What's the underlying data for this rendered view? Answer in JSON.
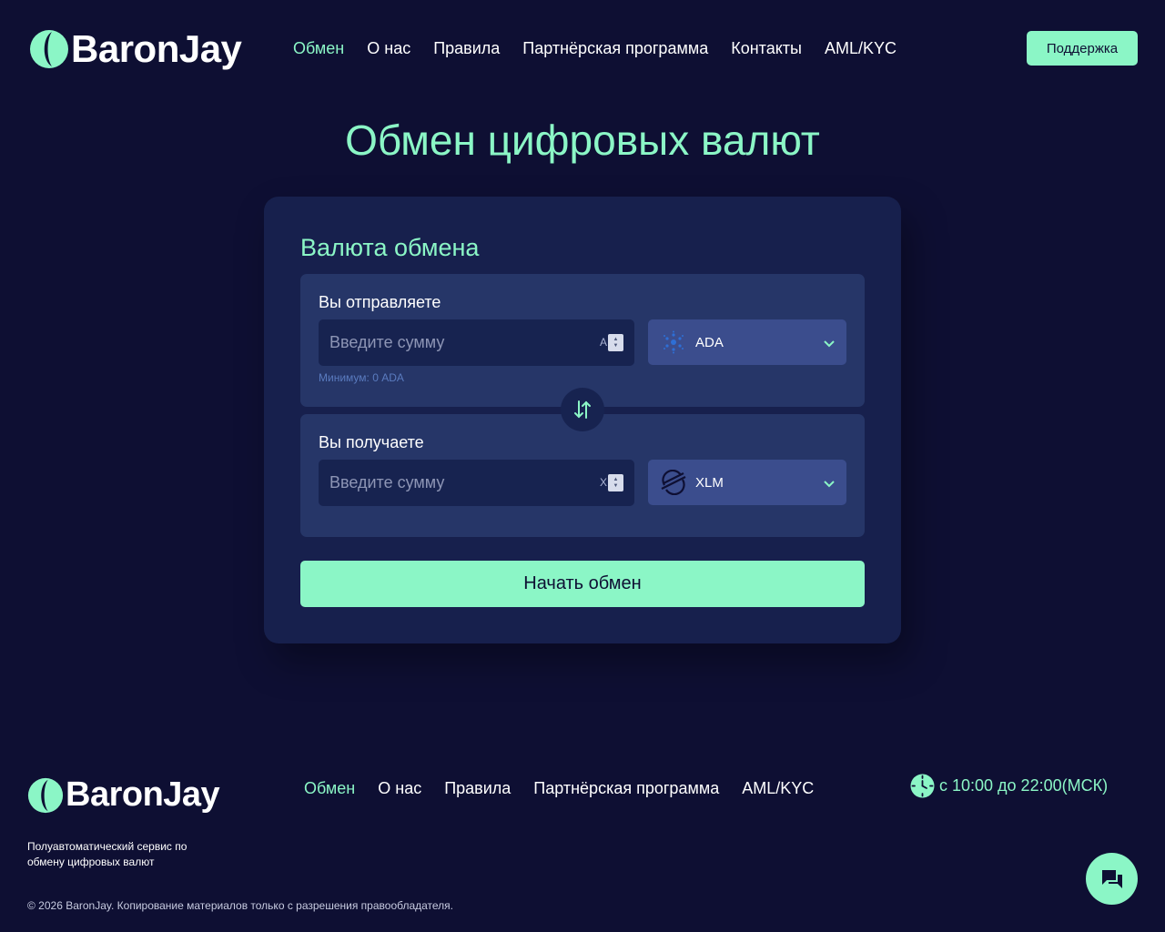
{
  "brand": {
    "name": "BaronJay",
    "accent_color": "#8bf6c6",
    "background_color": "#0e0f33"
  },
  "header": {
    "nav": [
      {
        "label": "Обмен",
        "active": true
      },
      {
        "label": "О нас",
        "active": false
      },
      {
        "label": "Правила",
        "active": false
      },
      {
        "label": "Партнёрская программа",
        "active": false
      },
      {
        "label": "Контакты",
        "active": false
      },
      {
        "label": "AML/KYC",
        "active": false
      }
    ],
    "support_label": "Поддержка"
  },
  "main": {
    "title": "Обмен цифровых валют",
    "card": {
      "title": "Валюта обмена",
      "send": {
        "label": "Вы отправляете",
        "placeholder": "Введите сумму",
        "unit": "A",
        "currency": "ADA",
        "currency_icon": "cardano-icon",
        "minimum": "Минимум: 0 ADA"
      },
      "receive": {
        "label": "Вы получаете",
        "placeholder": "Введите сумму",
        "unit": "X",
        "currency": "XLM",
        "currency_icon": "stellar-icon"
      },
      "start_label": "Начать обмен"
    }
  },
  "footer": {
    "nav": [
      {
        "label": "Обмен",
        "active": true
      },
      {
        "label": "О нас",
        "active": false
      },
      {
        "label": "Правила",
        "active": false
      },
      {
        "label": "Партнёрская программа",
        "active": false
      },
      {
        "label": "AML/KYC",
        "active": false
      }
    ],
    "hours": "с 10:00 до 22:00(МСК)",
    "tagline": "Полуавтоматический сервис по обмену цифровых валют",
    "copyright": "© 2026 BaronJay. Копирование материалов только с разрешения правообладателя."
  }
}
